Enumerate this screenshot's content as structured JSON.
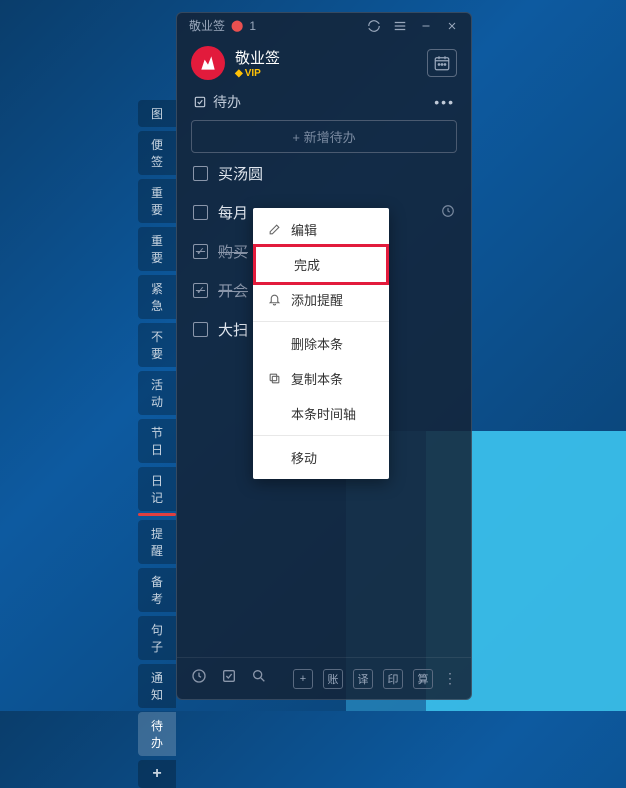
{
  "titlebar": {
    "app": "敬业签",
    "notif_count": "1"
  },
  "header": {
    "app_name": "敬业签",
    "vip": "VIP"
  },
  "subheader": {
    "title": "待办"
  },
  "add_button": "+ 新增待办",
  "sidebar": {
    "tabs": [
      "图",
      "便签",
      "重要",
      "重要",
      "紧急",
      "不要",
      "活动",
      "节日",
      "日记",
      "提醒",
      "备考",
      "句子",
      "通知",
      "待办"
    ],
    "add": "+"
  },
  "todos": [
    {
      "text": "买汤圆",
      "done": false,
      "reminder": false
    },
    {
      "text": "每月",
      "done": false,
      "reminder": true
    },
    {
      "text": "购买",
      "done": true,
      "reminder": false
    },
    {
      "text": "开会",
      "done": true,
      "reminder": false
    },
    {
      "text": "大扫",
      "done": false,
      "reminder": false
    }
  ],
  "context_menu": {
    "edit": "编辑",
    "complete": "完成",
    "add_reminder": "添加提醒",
    "delete": "删除本条",
    "copy": "复制本条",
    "timeline": "本条时间轴",
    "move": "移动"
  },
  "bottom": {
    "btns": [
      "账",
      "译",
      "印",
      "算"
    ]
  }
}
